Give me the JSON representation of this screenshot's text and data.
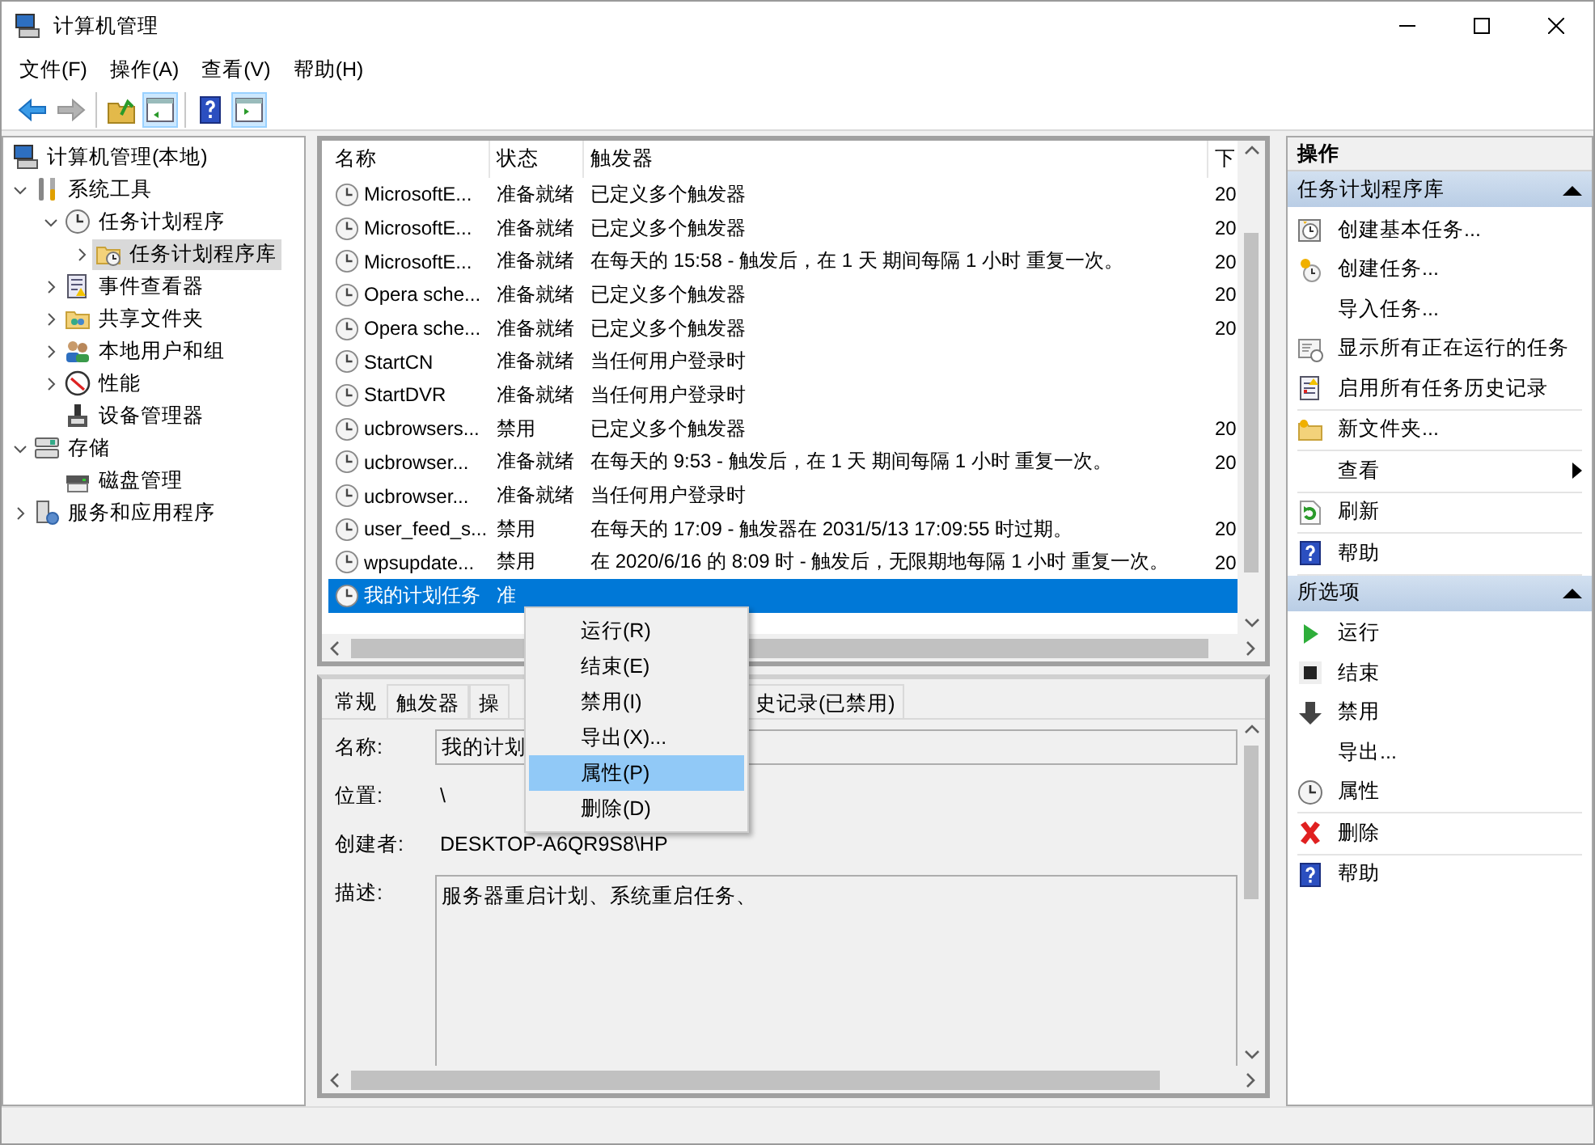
{
  "window": {
    "title": "计算机管理"
  },
  "menu": [
    "文件(F)",
    "操作(A)",
    "查看(V)",
    "帮助(H)"
  ],
  "toolbar": {
    "groups": [
      {
        "buttons": [
          {
            "kind": "back",
            "disabled": false,
            "pressed": false
          },
          {
            "kind": "forward",
            "disabled": true,
            "pressed": false
          }
        ]
      },
      {
        "buttons": [
          {
            "kind": "up",
            "disabled": false,
            "pressed": false
          },
          {
            "kind": "tree-pane",
            "disabled": false,
            "pressed": true
          }
        ]
      },
      {
        "buttons": [
          {
            "kind": "help",
            "disabled": false,
            "pressed": false
          },
          {
            "kind": "action-pane",
            "disabled": false,
            "pressed": true
          }
        ]
      }
    ]
  },
  "tree": {
    "items": [
      {
        "label": "计算机管理(本地)",
        "kind": "computer",
        "expandable": false,
        "selected": false,
        "children": [
          {
            "label": "系统工具",
            "kind": "tools",
            "expandable": true,
            "expanded": true,
            "selected": false,
            "children": [
              {
                "label": "任务计划程序",
                "kind": "clock",
                "expandable": true,
                "expanded": true,
                "selected": false,
                "children": [
                  {
                    "label": "任务计划程序库",
                    "kind": "folder-clock",
                    "expandable": true,
                    "expanded": false,
                    "selected": true
                  }
                ]
              },
              {
                "label": "事件查看器",
                "kind": "event-log",
                "expandable": true,
                "expanded": false,
                "selected": false
              },
              {
                "label": "共享文件夹",
                "kind": "shared-folder",
                "expandable": true,
                "expanded": false,
                "selected": false
              },
              {
                "label": "本地用户和组",
                "kind": "users",
                "expandable": true,
                "expanded": false,
                "selected": false
              },
              {
                "label": "性能",
                "kind": "performance",
                "expandable": true,
                "expanded": false,
                "selected": false
              },
              {
                "label": "设备管理器",
                "kind": "device",
                "expandable": false,
                "selected": false
              }
            ]
          },
          {
            "label": "存储",
            "kind": "storage",
            "expandable": true,
            "expanded": true,
            "selected": false,
            "children": [
              {
                "label": "磁盘管理",
                "kind": "disk",
                "expandable": false,
                "selected": false
              }
            ]
          },
          {
            "label": "服务和应用程序",
            "kind": "services",
            "expandable": true,
            "expanded": false,
            "selected": false
          }
        ]
      }
    ]
  },
  "table": {
    "columns": [
      "名称",
      "状态",
      "触发器",
      "下"
    ],
    "rows": [
      {
        "name": "MicrosoftE...",
        "status": "准备就绪",
        "trigger": "已定义多个触发器",
        "next": "20",
        "selected": false
      },
      {
        "name": "MicrosoftE...",
        "status": "准备就绪",
        "trigger": "已定义多个触发器",
        "next": "20",
        "selected": false
      },
      {
        "name": "MicrosoftE...",
        "status": "准备就绪",
        "trigger": "在每天的 15:58 - 触发后，在 1 天 期间每隔 1 小时 重复一次。",
        "next": "20",
        "selected": false
      },
      {
        "name": "Opera sche...",
        "status": "准备就绪",
        "trigger": "已定义多个触发器",
        "next": "20",
        "selected": false
      },
      {
        "name": "Opera sche...",
        "status": "准备就绪",
        "trigger": "已定义多个触发器",
        "next": "20",
        "selected": false
      },
      {
        "name": "StartCN",
        "status": "准备就绪",
        "trigger": "当任何用户登录时",
        "selected": false
      },
      {
        "name": "StartDVR",
        "status": "准备就绪",
        "trigger": "当任何用户登录时",
        "selected": false
      },
      {
        "name": "ucbrowsers...",
        "status": "禁用",
        "trigger": "已定义多个触发器",
        "next": "20",
        "selected": false
      },
      {
        "name": "ucbrowser...",
        "status": "准备就绪",
        "trigger": "在每天的 9:53 - 触发后，在 1 天 期间每隔 1 小时 重复一次。",
        "next": "20",
        "selected": false
      },
      {
        "name": "ucbrowser...",
        "status": "准备就绪",
        "trigger": "当任何用户登录时",
        "selected": false
      },
      {
        "name": "user_feed_s...",
        "status": "禁用",
        "trigger": "在每天的 17:09 - 触发器在 2031/5/13 17:09:55 时过期。",
        "next": "20",
        "selected": false
      },
      {
        "name": "wpsupdate...",
        "status": "禁用",
        "trigger": "在 2020/6/16 的 8:09 时 - 触发后，无限期地每隔 1 小时 重复一次。",
        "next": "20",
        "selected": false
      },
      {
        "name": "我的计划任务",
        "status": "准",
        "selected": true
      }
    ]
  },
  "context_menu": [
    {
      "label": "运行(R)",
      "selected": false
    },
    {
      "label": "结束(E)",
      "selected": false
    },
    {
      "label": "禁用(I)",
      "selected": false
    },
    {
      "label": "导出(X)...",
      "selected": false
    },
    {
      "label": "属性(P)",
      "selected": true
    },
    {
      "label": "删除(D)",
      "selected": false
    }
  ],
  "details": {
    "tabs": [
      {
        "label": "常规",
        "selected": true
      },
      {
        "label": "触发器",
        "selected": false
      },
      {
        "label": "操",
        "selected": false
      },
      {
        "label": "史记录(已禁用)",
        "selected": false
      }
    ],
    "name_label": "名称:",
    "name_value": "我的计划",
    "location_label": "位置:",
    "location_value": "\\",
    "author_label": "创建者:",
    "author_value": "DESKTOP-A6QR9S8\\HP",
    "description_label": "描述:",
    "description_value": "服务器重启计划、系统重启任务、"
  },
  "actions": {
    "title": "操作",
    "sections": [
      {
        "title": "任务计划程序库",
        "expanded": true,
        "groups": [
          {
            "items": [
              {
                "label": "创建基本任务...",
                "kind": "create-basic"
              },
              {
                "label": "创建任务...",
                "kind": "create"
              },
              {
                "label": "导入任务...",
                "kind": "none"
              },
              {
                "label": "显示所有正在运行的任务",
                "kind": "running"
              },
              {
                "label": "启用所有任务历史记录",
                "kind": "history"
              }
            ]
          },
          {
            "items": [
              {
                "label": "新文件夹...",
                "kind": "folder"
              }
            ]
          },
          {
            "items": [
              {
                "label": "查看",
                "kind": "submenu"
              }
            ]
          },
          {
            "items": [
              {
                "label": "刷新",
                "kind": "refresh"
              }
            ]
          },
          {
            "items": [
              {
                "label": "帮助",
                "kind": "help"
              }
            ]
          }
        ]
      },
      {
        "title": "所选项",
        "expanded": true,
        "groups": [
          {
            "items": [
              {
                "label": "运行",
                "kind": "run"
              },
              {
                "label": "结束",
                "kind": "stop"
              },
              {
                "label": "禁用",
                "kind": "disable"
              },
              {
                "label": "导出...",
                "kind": "none"
              },
              {
                "label": "属性",
                "kind": "properties"
              }
            ]
          },
          {
            "items": [
              {
                "label": "删除",
                "kind": "delete"
              }
            ]
          },
          {
            "items": [
              {
                "label": "帮助",
                "kind": "help"
              }
            ]
          }
        ]
      }
    ]
  }
}
